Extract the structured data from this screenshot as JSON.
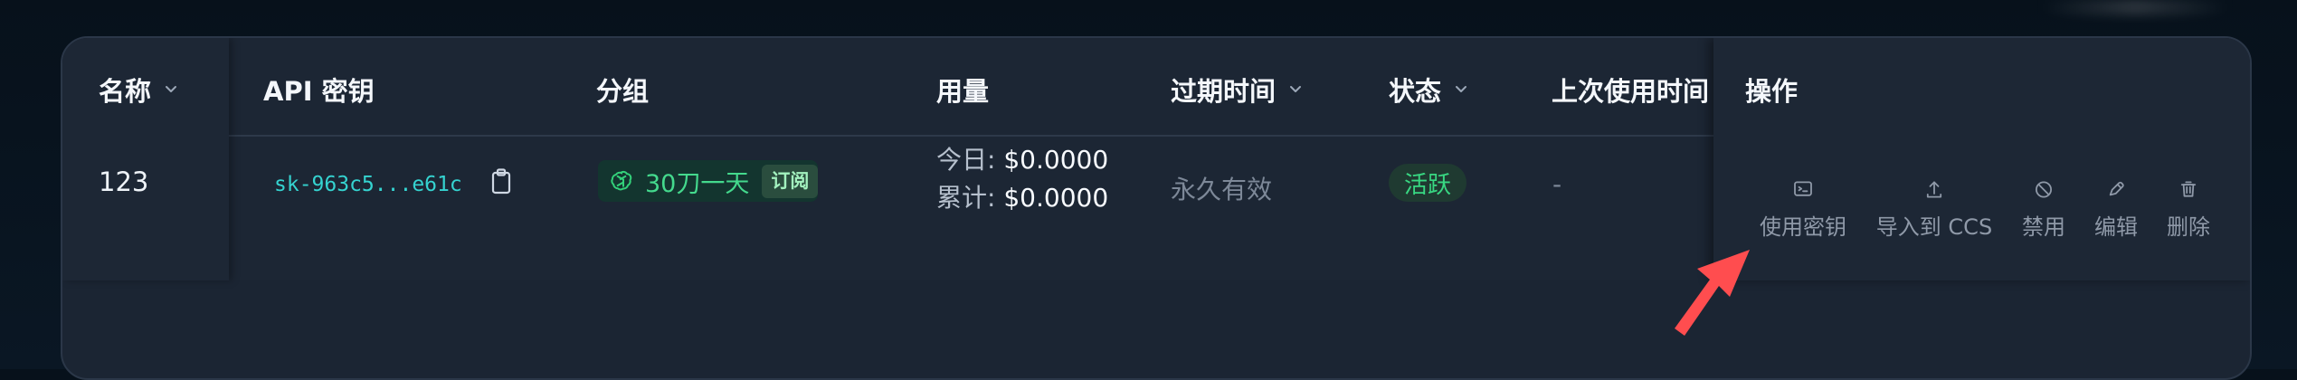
{
  "table": {
    "headers": {
      "name": "名称",
      "api_key": "API 密钥",
      "group": "分组",
      "usage": "用量",
      "expiry": "过期时间",
      "status": "状态",
      "last_used": "上次使用时间",
      "actions": "操作"
    },
    "row": {
      "name": "123",
      "api_key": "sk-963c5...e61c",
      "group": {
        "icon": "openai-icon",
        "label": "30刀一天",
        "badge": "订阅"
      },
      "usage": {
        "today_label": "今日:",
        "today_value": "$0.0000",
        "total_label": "累计:",
        "total_value": "$0.0000"
      },
      "expiry": "永久有效",
      "status": "活跃",
      "last_used": "-",
      "actions": [
        {
          "icon": "terminal-icon",
          "label": "使用密钥"
        },
        {
          "icon": "upload-icon",
          "label": "导入到 CCS"
        },
        {
          "icon": "ban-icon",
          "label": "禁用"
        },
        {
          "icon": "edit-icon",
          "label": "编辑"
        },
        {
          "icon": "trash-icon",
          "label": "删除"
        }
      ]
    }
  },
  "colors": {
    "background": "#07111b",
    "panel": "#1b2533",
    "accent_cyan": "#35d3d0",
    "accent_green": "#38d782",
    "muted_text": "#8f99a8",
    "arrow_red": "#ff4d4f"
  }
}
